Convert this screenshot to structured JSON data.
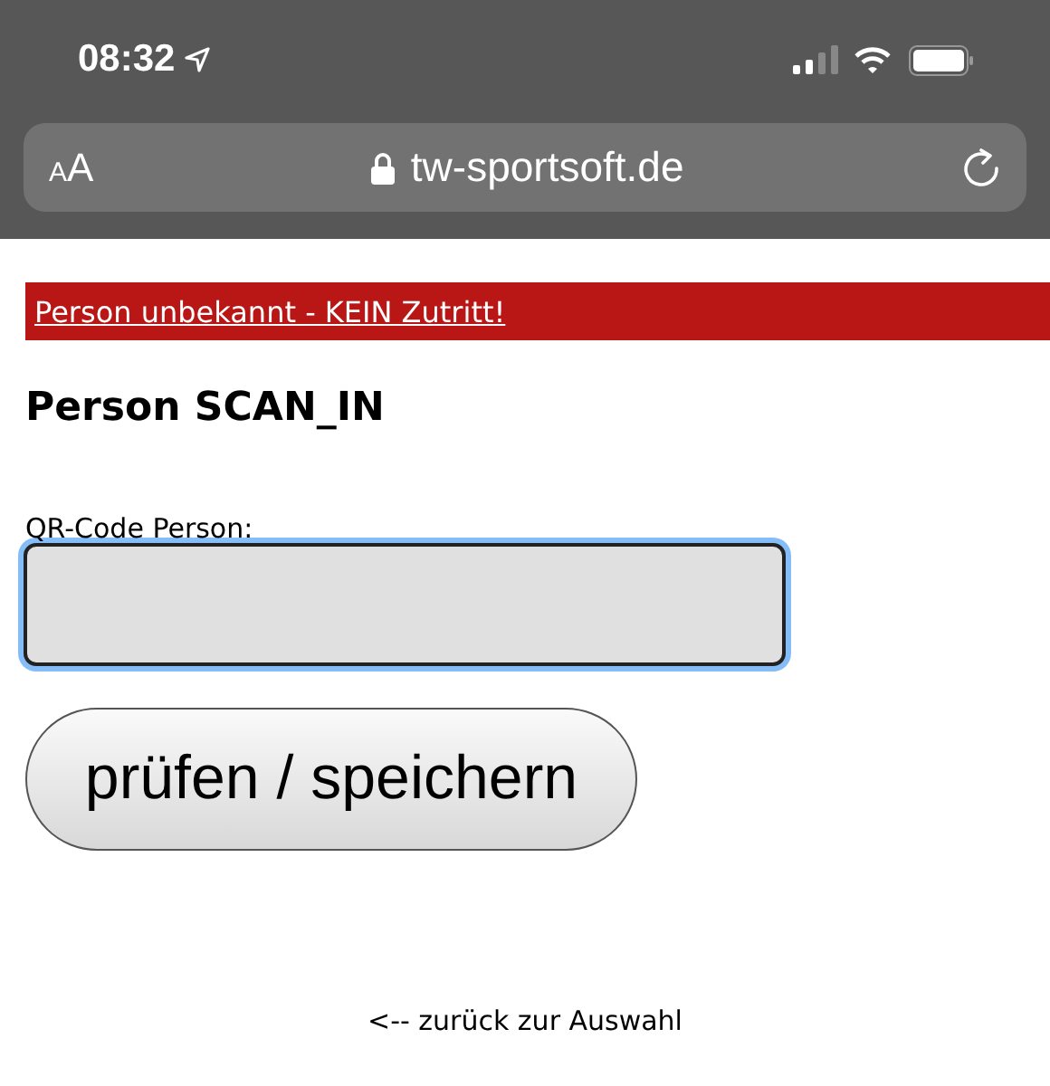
{
  "status_bar": {
    "time": "08:32"
  },
  "address_bar": {
    "text_size_button": "AA",
    "url": "tw-sportsoft.de"
  },
  "alert": {
    "text": "Person unbekannt - KEIN Zutritt!"
  },
  "heading": "Person SCAN_IN",
  "qr_field": {
    "label": "QR-Code Person:",
    "focused": true
  },
  "submit_button": "prüfen / speichern",
  "back_link": "<-- zurück zur Auswahl"
}
